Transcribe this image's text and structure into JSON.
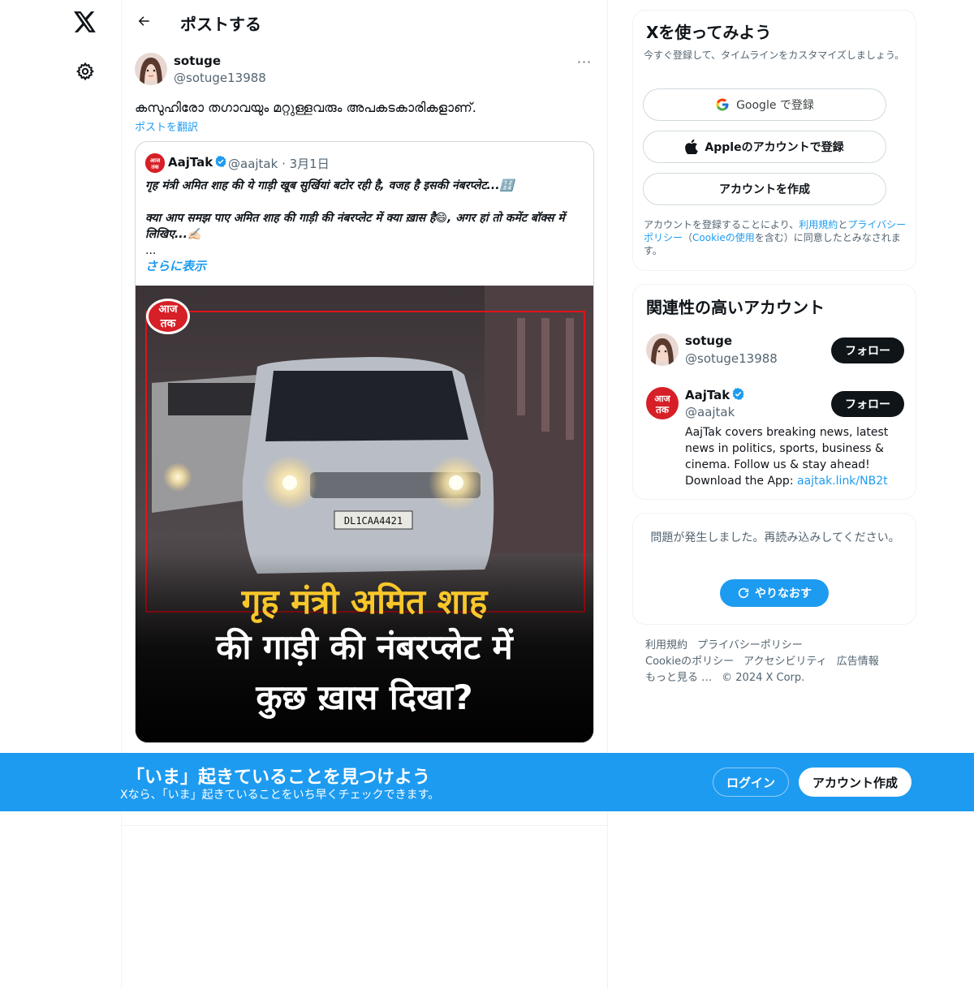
{
  "header": {
    "title": "ポストする"
  },
  "post": {
    "author_name": "sotuge",
    "author_handle": "@sotuge13988",
    "more": "···",
    "text": "കസുഹിരോ തഗാവയും മറ്റുള്ളവരും അപകടകാരികളാണ്.",
    "translate_label": "ポストを翻訳",
    "quote": {
      "name": "AajTak",
      "handle_date": "@aajtak · 3月1日",
      "line1": "गृह मंत्री अमित शाह की ये गाड़ी खूब सुर्खियां बटोर रही है, वजह है इसकी नंबरप्लेट...🔢",
      "line2": "",
      "line3": "क्या आप समझ पाए अमित शाह की गाड़ी की नंबरप्लेट में क्या ख़ास है😄, अगर हां तो कमेंट बॉक्स में",
      "line4": "लिखिए...✍🏻",
      "line5": "...",
      "show_more": "さらに表示",
      "media": {
        "logo": "आज तक",
        "plate": "DL1CAA4421",
        "caption1": "गृह मंत्री अमित शाह",
        "caption2": "की गाड़ी की नंबरप्लेट में",
        "caption3": "कुछ ख़ास दिखा?"
      }
    }
  },
  "signup_card": {
    "title": "Xを使ってみよう",
    "subtitle": "今すぐ登録して、タイムラインをカスタマイズしましょう。",
    "google_label": "Google で登録",
    "apple_label": "Appleのアカウントで登録",
    "create_label": "アカウントを作成",
    "legal_1": "アカウントを登録することにより、",
    "legal_terms": "利用規約",
    "legal_2": "と",
    "legal_privacy": "プライバシーポリシー",
    "legal_3": "（",
    "legal_cookie": "Cookieの使用",
    "legal_4": "を含む）に同意したとみなされます。"
  },
  "related": {
    "title": "関連性の高いアカウント",
    "accounts": [
      {
        "name": "sotuge",
        "handle": "@sotuge13988",
        "follow": "フォロー"
      },
      {
        "name": "AajTak",
        "handle": "@aajtak",
        "follow": "フォロー",
        "bio": "AajTak covers breaking news, latest news in politics, sports, business & cinema. Follow us & stay ahead! Download the App: ",
        "bio_link": "aajtak.link/NB2t"
      }
    ]
  },
  "error_card": {
    "text": "問題が発生しました。再読み込みしてください。",
    "retry": "やりなおす"
  },
  "footer": {
    "links": [
      "利用規約",
      "プライバシーポリシー",
      "Cookieのポリシー",
      "アクセシビリティ",
      "広告情報",
      "もっと見る …"
    ],
    "copyright": "© 2024 X Corp."
  },
  "bottom_bar": {
    "title": "「いま」起きていることを見つけよう",
    "subtitle": "Xなら、「いま」起きていることをいち早くチェックできます。",
    "login": "ログイン",
    "create": "アカウント作成"
  },
  "colors": {
    "accent": "#1d9bf0",
    "text": "#0f1419",
    "muted": "#536471",
    "caption_yellow": "#f8c72a",
    "aajtak_red": "#d61f26"
  }
}
